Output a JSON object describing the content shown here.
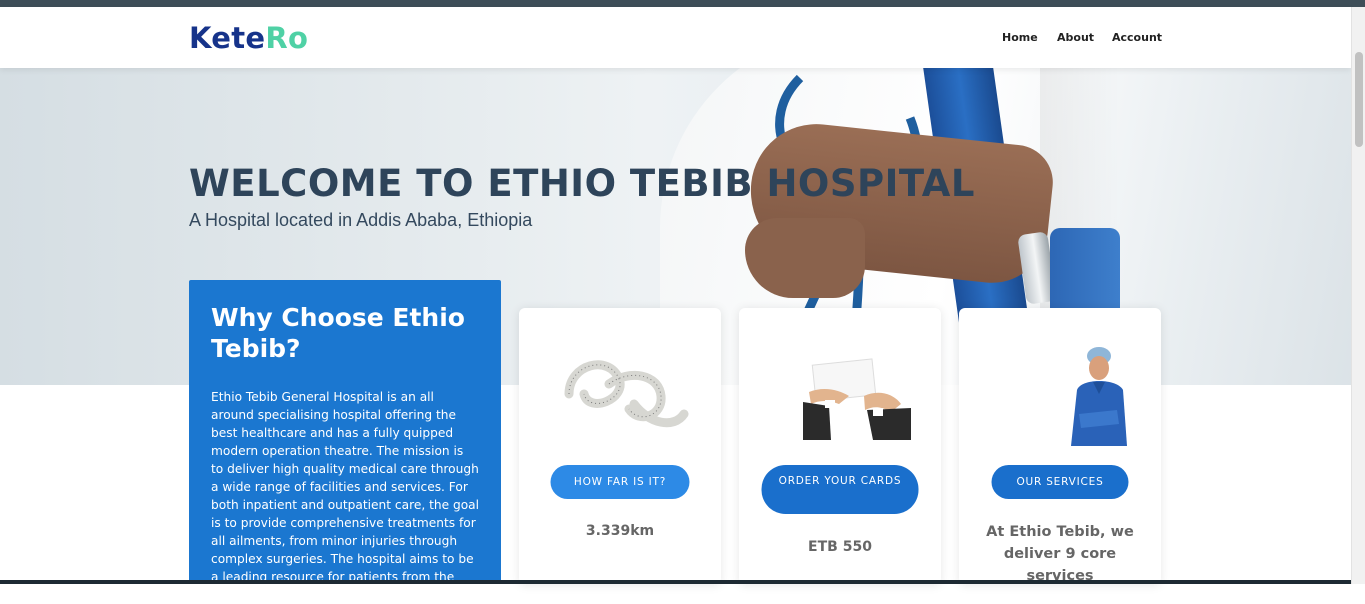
{
  "brand": {
    "part1": "Kete",
    "part2": "Ro",
    "color1": "#16338a",
    "color2": "#4fd1a5"
  },
  "nav": {
    "items": [
      "Home",
      "About",
      "Account"
    ]
  },
  "hero": {
    "title": "WELCOME TO ETHIO TEBIB HOSPITAL",
    "subtitle": "A Hospital located in Addis Ababa, Ethiopia",
    "image_icon": "doctor-with-stethoscope-image"
  },
  "why": {
    "title": "Why Choose Ethio Tebib?",
    "body": "Ethio Tebib General Hospital is an all around specialising hospital offering the best healthcare and has a fully quipped modern operation theatre. The mission is to deliver high quality medical care through a wide range of facilities and services. For both inpatient and outpatient care, the goal is to provide comprehensive treatments for all ailments, from minor injuries through complex surgeries. The hospital aims to be a leading resource for patients from the region, guaranteeing state of"
  },
  "cards": [
    {
      "image": "measuring-tape-image",
      "button": "HOW FAR IS IT?",
      "value": "3.339km"
    },
    {
      "image": "business-card-hands-image",
      "button": "ORDER YOUR CARDS",
      "value": "ETB 550"
    },
    {
      "image": "surgeon-image",
      "button": "OUR SERVICES",
      "value": "At Ethio Tebib, we deliver 9 core services"
    }
  ],
  "colors": {
    "primary": "#1b77d0",
    "button_light": "#2d8ae6",
    "title": "#2e445a"
  }
}
